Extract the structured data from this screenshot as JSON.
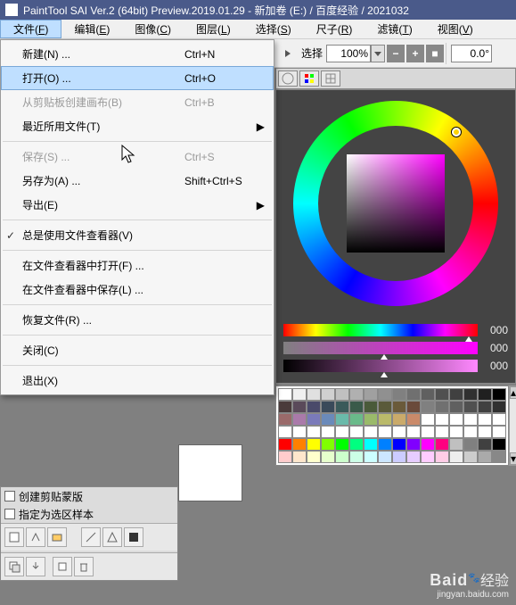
{
  "title": "PaintTool SAI Ver.2 (64bit) Preview.2019.01.29 - 新加卷 (E:) / 百度经验 / 2021032",
  "menubar": {
    "file": {
      "label": "文件(",
      "mnemonic": "F",
      "suffix": ")"
    },
    "edit": {
      "label": "编辑(",
      "mnemonic": "E",
      "suffix": ")"
    },
    "image": {
      "label": "图像(",
      "mnemonic": "C",
      "suffix": ")"
    },
    "layer": {
      "label": "图层(",
      "mnemonic": "L",
      "suffix": ")"
    },
    "select": {
      "label": "选择(",
      "mnemonic": "S",
      "suffix": ")"
    },
    "ruler": {
      "label": "尺子(",
      "mnemonic": "R",
      "suffix": ")"
    },
    "filter": {
      "label": "滤镜(",
      "mnemonic": "T",
      "suffix": ")"
    },
    "view": {
      "label": "视图(",
      "mnemonic": "V",
      "suffix": ")"
    }
  },
  "toolbar": {
    "select_label": "选择",
    "zoom": "100%",
    "rotation": "0.0°"
  },
  "file_menu": {
    "new": {
      "label": "新建(N) ...",
      "shortcut": "Ctrl+N"
    },
    "open": {
      "label": "打开(O) ...",
      "shortcut": "Ctrl+O"
    },
    "from_clip": {
      "label": "从剪贴板创建画布(B)",
      "shortcut": "Ctrl+B"
    },
    "recent": {
      "label": "最近所用文件(T)"
    },
    "save": {
      "label": "保存(S) ...",
      "shortcut": "Ctrl+S"
    },
    "save_as": {
      "label": "另存为(A) ...",
      "shortcut": "Shift+Ctrl+S"
    },
    "export": {
      "label": "导出(E)"
    },
    "use_viewer": {
      "label": "总是使用文件查看器(V)"
    },
    "open_in_viewer": {
      "label": "在文件查看器中打开(F) ..."
    },
    "save_in_viewer": {
      "label": "在文件查看器中保存(L) ..."
    },
    "revert": {
      "label": "恢复文件(R) ..."
    },
    "close": {
      "label": "关闭(C)"
    },
    "exit": {
      "label": "退出(X)"
    }
  },
  "sliders": {
    "v1": "000",
    "v2": "000",
    "v3": "000"
  },
  "layer_panel": {
    "clip_mask": "创建剪贴蒙版",
    "as_selection": "指定为选区样本"
  },
  "swatch_colors": [
    "#ffffff",
    "#f0f0f0",
    "#e0e0e0",
    "#d0d0d0",
    "#c0c0c0",
    "#b0b0b0",
    "#a0a0a0",
    "#909090",
    "#808080",
    "#707070",
    "#606060",
    "#505050",
    "#404040",
    "#303030",
    "#202020",
    "#000000",
    "#4a3b3b",
    "#5a4a5a",
    "#4a4a6a",
    "#3a4a5a",
    "#3a5a5a",
    "#3a5a4a",
    "#4a5a3a",
    "#5a5a3a",
    "#6a5a3a",
    "#6a4a3a",
    "#808080",
    "#707070",
    "#606060",
    "#505050",
    "#404040",
    "#303030",
    "#9a6a6a",
    "#aa7aaa",
    "#7a7aba",
    "#6a8aba",
    "#6abaaa",
    "#6aba8a",
    "#9aba6a",
    "#baba6a",
    "#caaa6a",
    "#ca8a6a",
    "#ffffff",
    "#ffffff",
    "#ffffff",
    "#ffffff",
    "#ffffff",
    "#ffffff",
    "#ffffff",
    "#ffffff",
    "#ffffff",
    "#ffffff",
    "#ffffff",
    "#ffffff",
    "#ffffff",
    "#ffffff",
    "#ffffff",
    "#ffffff",
    "#ffffff",
    "#ffffff",
    "#ffffff",
    "#ffffff",
    "#ffffff",
    "#ffffff",
    "#ff0000",
    "#ff8000",
    "#ffff00",
    "#80ff00",
    "#00ff00",
    "#00ff80",
    "#00ffff",
    "#0080ff",
    "#0000ff",
    "#8000ff",
    "#ff00ff",
    "#ff0080",
    "#c0c0c0",
    "#808080",
    "#404040",
    "#000000",
    "#ffcccc",
    "#ffe6cc",
    "#ffffcc",
    "#e6ffcc",
    "#ccffcc",
    "#ccffe6",
    "#ccffff",
    "#cce6ff",
    "#ccccff",
    "#e6ccff",
    "#ffccff",
    "#ffcce6",
    "#eeeeee",
    "#cccccc",
    "#aaaaaa",
    "#888888"
  ],
  "watermark": {
    "main": "Baid",
    "brand": "经验",
    "sub": "jingyan.baidu.com"
  }
}
